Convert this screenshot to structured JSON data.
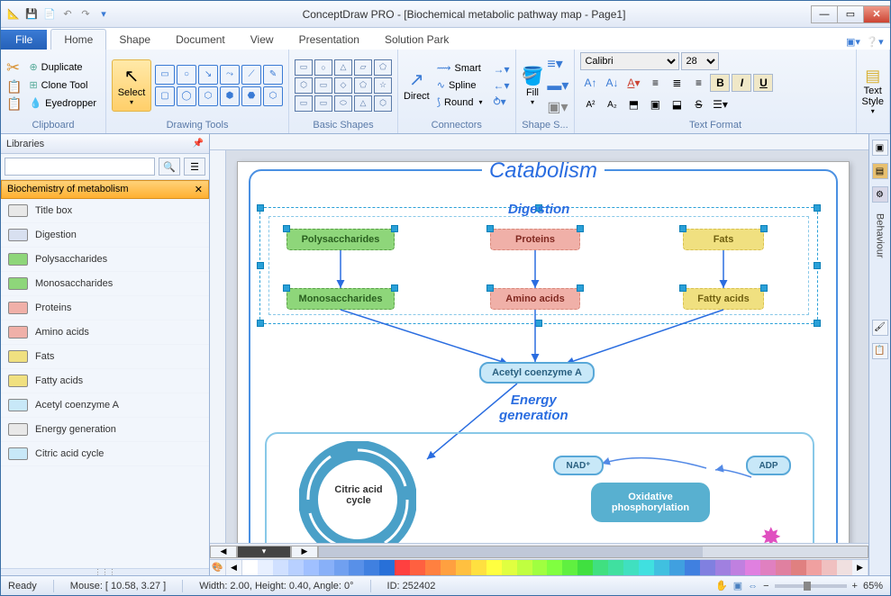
{
  "titlebar": {
    "title": "ConceptDraw PRO - [Biochemical metabolic pathway map - Page1]"
  },
  "tabs": {
    "file": "File",
    "items": [
      "Home",
      "Shape",
      "Document",
      "View",
      "Presentation",
      "Solution Park"
    ],
    "active": 0
  },
  "ribbon": {
    "clipboard": {
      "label": "Clipboard",
      "duplicate": "Duplicate",
      "clone": "Clone Tool",
      "eyedropper": "Eyedropper"
    },
    "select": "Select",
    "drawing": {
      "label": "Drawing Tools"
    },
    "basic": {
      "label": "Basic Shapes"
    },
    "connectors": {
      "label": "Connectors",
      "direct": "Direct",
      "smart": "Smart",
      "spline": "Spline",
      "round": "Round"
    },
    "fill": "Fill",
    "shape_s": "Shape S...",
    "font": {
      "name": "Calibri",
      "size": "28",
      "label": "Text Format"
    },
    "text_style": "Text\nStyle"
  },
  "libs": {
    "header": "Libraries",
    "search_placeholder": "",
    "category": "Biochemistry of  metabolism",
    "items": [
      {
        "label": "Title box",
        "color": "#e8e8e8"
      },
      {
        "label": "Digestion",
        "color": "#d8e0f0"
      },
      {
        "label": "Polysaccharides",
        "color": "#8ed67a"
      },
      {
        "label": "Monosaccharides",
        "color": "#8ed67a"
      },
      {
        "label": "Proteins",
        "color": "#f0b0a8"
      },
      {
        "label": "Amino acids",
        "color": "#f0b0a8"
      },
      {
        "label": "Fats",
        "color": "#f0e080"
      },
      {
        "label": "Fatty acids",
        "color": "#f0e080"
      },
      {
        "label": "Acetyl coenzyme A",
        "color": "#c8e8f8"
      },
      {
        "label": "Energy generation",
        "color": "#e8e8e8"
      },
      {
        "label": "Citric acid cycle",
        "color": "#c8e8f8"
      }
    ]
  },
  "diagram": {
    "main_title": "Catabolism",
    "digestion": "Digestion",
    "poly": "Polysaccharides",
    "mono": "Monosaccharides",
    "prot": "Proteins",
    "amino": "Amino acids",
    "fats": "Fats",
    "fatty": "Fatty acids",
    "acetyl": "Acetyl coenzyme A",
    "energy": "Energy\ngeneration",
    "citric": "Citric acid cycle",
    "nad": "NAD⁺",
    "oxid": "Oxidative phosphorylation",
    "adp": "ADP"
  },
  "rail": {
    "behaviour": "Behaviour"
  },
  "status": {
    "ready": "Ready",
    "mouse": "Mouse: [ 10.58, 3.27 ]",
    "dims": "Width: 2.00,  Height: 0.40,  Angle: 0°",
    "id": "ID: 252402",
    "zoom": "65%"
  },
  "colors": [
    "#fff",
    "#e8f0ff",
    "#d0e0ff",
    "#b8d0ff",
    "#a0c0ff",
    "#88b0f8",
    "#70a0f0",
    "#5890e8",
    "#4080e0",
    "#2870d8",
    "#ff4040",
    "#ff6040",
    "#ff8040",
    "#ffa040",
    "#ffc040",
    "#ffe040",
    "#ffff40",
    "#e0ff40",
    "#c0ff40",
    "#a0ff40",
    "#80ff40",
    "#60f040",
    "#40e040",
    "#40e080",
    "#40e0a0",
    "#40e0c0",
    "#40e0e0",
    "#40c0e0",
    "#40a0e0",
    "#4080e0",
    "#8080e0",
    "#a080e0",
    "#c080e0",
    "#e080e0",
    "#e080c0",
    "#e080a0",
    "#e08080",
    "#f0a0a0",
    "#f0c0c0",
    "#f0e0e0"
  ]
}
